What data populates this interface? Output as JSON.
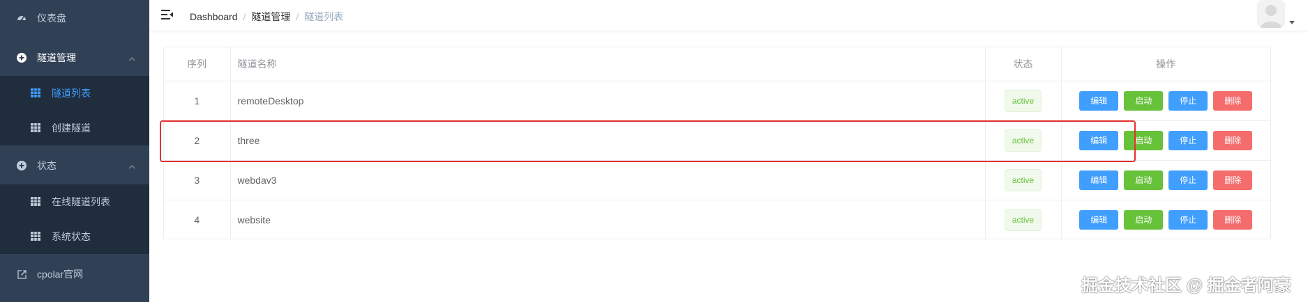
{
  "sidebar": {
    "dashboard": {
      "label": "仪表盘",
      "icon": "dashboard-icon"
    },
    "tunnel_mgmt": {
      "label": "隧道管理",
      "icon": "circle-plus-icon",
      "expanded": true,
      "items": [
        {
          "label": "隧道列表",
          "icon": "table-icon",
          "active": true
        },
        {
          "label": "创建隧道",
          "icon": "table-icon",
          "active": false
        }
      ]
    },
    "status": {
      "label": "状态",
      "icon": "circle-plus-icon",
      "expanded": true,
      "items": [
        {
          "label": "在线隧道列表",
          "icon": "table-icon"
        },
        {
          "label": "系统状态",
          "icon": "table-icon"
        }
      ]
    },
    "external": {
      "label": "cpolar官网",
      "icon": "external-link-icon"
    }
  },
  "header": {
    "breadcrumb": [
      "Dashboard",
      "隧道管理",
      "隧道列表"
    ],
    "separator": "/"
  },
  "table": {
    "columns": [
      "序列",
      "隧道名称",
      "状态",
      "操作"
    ],
    "rows": [
      {
        "index": "1",
        "name": "remoteDesktop",
        "status": "active"
      },
      {
        "index": "2",
        "name": "three",
        "status": "active"
      },
      {
        "index": "3",
        "name": "webdav3",
        "status": "active"
      },
      {
        "index": "4",
        "name": "website",
        "status": "active"
      }
    ],
    "actions": {
      "edit": "编辑",
      "start": "启动",
      "stop": "停止",
      "delete": "删除"
    }
  },
  "highlighted_row": "2",
  "watermark": "掘金技术社区 @ 掘金者阿豪",
  "colors": {
    "sidebar_bg": "#304156",
    "submenu_bg": "#1f2d3d",
    "active_text": "#409eff",
    "primary": "#409eff",
    "success": "#67c23a",
    "danger": "#f56c6c",
    "highlight_border": "#e3312d"
  }
}
